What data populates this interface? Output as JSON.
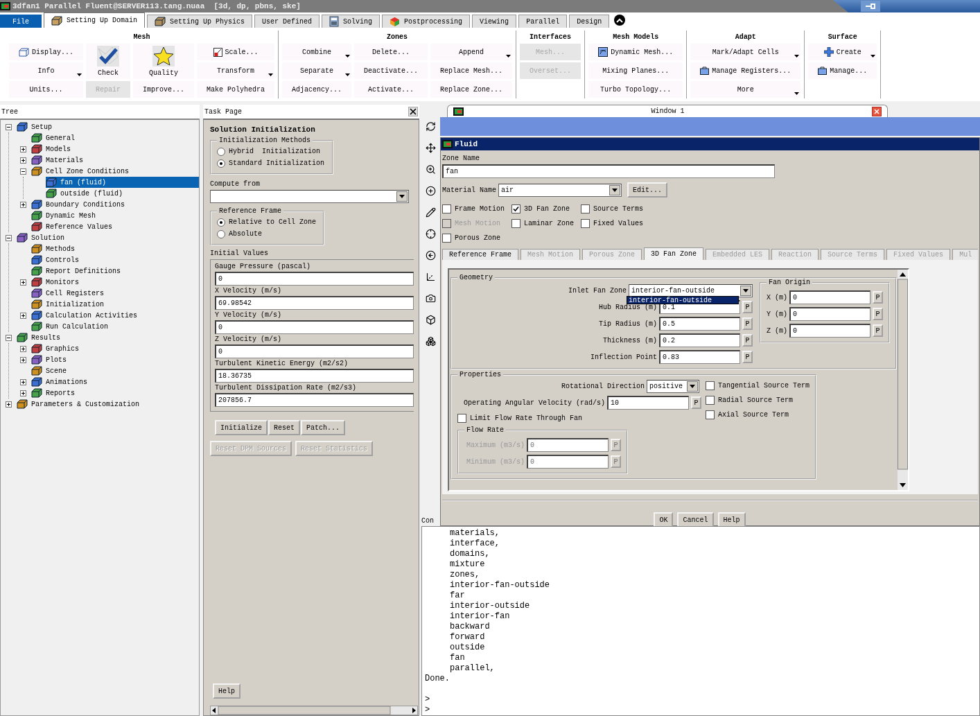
{
  "window": {
    "title": "3dfan1 Parallel Fluent@SERVER113.tang.nuaa  [3d, dp, pbns, ske]"
  },
  "ribbon_tabs": [
    {
      "label": "File",
      "kind": "file",
      "selected": false
    },
    {
      "label": "Setting Up Domain",
      "kind": "tab",
      "selected": true
    },
    {
      "label": "Setting Up Physics",
      "kind": "tab",
      "selected": false
    },
    {
      "label": "User Defined",
      "kind": "tab",
      "selected": false
    },
    {
      "label": "Solving",
      "kind": "tab",
      "selected": false
    },
    {
      "label": "Postprocessing",
      "kind": "tab",
      "selected": false
    },
    {
      "label": "Viewing",
      "kind": "tab",
      "selected": false
    },
    {
      "label": "Parallel",
      "kind": "tab",
      "selected": false
    },
    {
      "label": "Design",
      "kind": "tab",
      "selected": false
    }
  ],
  "ribbon_groups": [
    {
      "title": "Mesh",
      "columns": [
        [
          {
            "label": "Display...",
            "kind": "icon",
            "disabled": false
          },
          {
            "label": "Info",
            "kind": "menu",
            "disabled": false
          },
          {
            "label": "Units...",
            "kind": "plain",
            "disabled": false
          }
        ],
        [
          {
            "label": "Check",
            "kind": "large",
            "disabled": false
          },
          {
            "label": "Repair",
            "kind": "plain",
            "disabled": true
          }
        ],
        [
          {
            "label": "Quality",
            "kind": "large",
            "disabled": false
          },
          {
            "label": "Improve...",
            "kind": "plain",
            "disabled": false
          }
        ],
        [
          {
            "label": "Scale...",
            "kind": "icon",
            "disabled": false
          },
          {
            "label": "Transform",
            "kind": "menu",
            "disabled": false
          },
          {
            "label": "Make Polyhedra",
            "kind": "plain",
            "disabled": false
          }
        ]
      ]
    },
    {
      "title": "Zones",
      "columns": [
        [
          {
            "label": "Combine",
            "kind": "menu",
            "disabled": false
          },
          {
            "label": "Separate",
            "kind": "menu",
            "disabled": false
          },
          {
            "label": "Adjacency...",
            "kind": "plain",
            "disabled": false
          }
        ],
        [
          {
            "label": "Delete...",
            "kind": "plain",
            "disabled": false
          },
          {
            "label": "Deactivate...",
            "kind": "plain",
            "disabled": false
          },
          {
            "label": "Activate...",
            "kind": "plain",
            "disabled": false
          }
        ],
        [
          {
            "label": "Append",
            "kind": "menu",
            "disabled": false
          },
          {
            "label": "Replace Mesh...",
            "kind": "plain",
            "disabled": false
          },
          {
            "label": "Replace Zone...",
            "kind": "plain",
            "disabled": false
          }
        ]
      ]
    },
    {
      "title": "Interfaces",
      "columns": [
        [
          {
            "label": "Mesh...",
            "kind": "plain",
            "disabled": true
          },
          {
            "label": "Overset...",
            "kind": "plain",
            "disabled": true
          }
        ]
      ]
    },
    {
      "title": "Mesh Models",
      "columns": [
        [
          {
            "label": "Dynamic Mesh...",
            "kind": "icon",
            "disabled": false
          },
          {
            "label": "Mixing Planes...",
            "kind": "plain",
            "disabled": false
          },
          {
            "label": "Turbo Topology...",
            "kind": "plain",
            "disabled": false
          }
        ]
      ]
    },
    {
      "title": "Adapt",
      "columns": [
        [
          {
            "label": "Mark/Adapt Cells",
            "kind": "menu",
            "disabled": false
          },
          {
            "label": "Manage Registers...",
            "kind": "icon",
            "disabled": false
          },
          {
            "label": "More",
            "kind": "menu",
            "disabled": false
          }
        ]
      ]
    },
    {
      "title": "Surface",
      "columns": [
        [
          {
            "label": "Create",
            "kind": "icon-menu",
            "disabled": false
          },
          {
            "label": "Manage...",
            "kind": "icon",
            "disabled": false
          }
        ]
      ]
    }
  ],
  "tree": {
    "title": "Tree",
    "items": [
      {
        "label": "Setup",
        "expanded": true,
        "selected": false,
        "children": [
          {
            "label": "General",
            "selected": false
          },
          {
            "label": "Models",
            "expanded": false,
            "selected": false
          },
          {
            "label": "Materials",
            "expanded": false,
            "selected": false
          },
          {
            "label": "Cell Zone Conditions",
            "expanded": true,
            "selected": false,
            "children": [
              {
                "label": "fan (fluid)",
                "selected": true
              },
              {
                "label": "outside (fluid)",
                "selected": false
              }
            ]
          },
          {
            "label": "Boundary Conditions",
            "expanded": false,
            "selected": false
          },
          {
            "label": "Dynamic Mesh",
            "selected": false
          },
          {
            "label": "Reference Values",
            "selected": false
          }
        ]
      },
      {
        "label": "Solution",
        "expanded": true,
        "selected": false,
        "children": [
          {
            "label": "Methods",
            "selected": false
          },
          {
            "label": "Controls",
            "selected": false
          },
          {
            "label": "Report Definitions",
            "selected": false
          },
          {
            "label": "Monitors",
            "expanded": false,
            "selected": false
          },
          {
            "label": "Cell Registers",
            "selected": false
          },
          {
            "label": "Initialization",
            "selected": false
          },
          {
            "label": "Calculation Activities",
            "expanded": false,
            "selected": false
          },
          {
            "label": "Run Calculation",
            "selected": false
          }
        ]
      },
      {
        "label": "Results",
        "expanded": true,
        "selected": false,
        "children": [
          {
            "label": "Graphics",
            "expanded": false,
            "selected": false
          },
          {
            "label": "Plots",
            "expanded": false,
            "selected": false
          },
          {
            "label": "Scene",
            "selected": false
          },
          {
            "label": "Animations",
            "expanded": false,
            "selected": false
          },
          {
            "label": "Reports",
            "expanded": false,
            "selected": false
          }
        ]
      },
      {
        "label": "Parameters & Customization",
        "expanded": false,
        "selected": false
      }
    ]
  },
  "task_page": {
    "title": "Task Page",
    "heading": "Solution Initialization",
    "methods": {
      "legend": "Initialization Methods",
      "options": [
        {
          "label": "Hybrid  Initialization",
          "selected": false
        },
        {
          "label": "Standard Initialization",
          "selected": true
        }
      ]
    },
    "compute_from": {
      "label": "Compute from"
    },
    "reference_frame": {
      "legend": "Reference Frame",
      "options": [
        {
          "label": "Relative to Cell Zone",
          "selected": true
        },
        {
          "label": "Absolute",
          "selected": false
        }
      ]
    },
    "initial_values": {
      "label": "Initial Values",
      "fields": [
        {
          "label": "Gauge Pressure (pascal)",
          "value": "0"
        },
        {
          "label": "X Velocity (m/s)",
          "value": "69.98542"
        },
        {
          "label": "Y Velocity (m/s)",
          "value": "0"
        },
        {
          "label": "Z Velocity (m/s)",
          "value": "0"
        },
        {
          "label": "Turbulent Kinetic Energy (m2/s2)",
          "value": "18.36735"
        },
        {
          "label": "Turbulent Dissipation Rate (m2/s3)",
          "value": "207856.7"
        }
      ]
    },
    "buttons": [
      {
        "label": "Initialize",
        "disabled": false
      },
      {
        "label": "Reset",
        "disabled": false
      },
      {
        "label": "Patch...",
        "disabled": false
      }
    ],
    "reset_buttons": [
      {
        "label": "Reset DPM Sources",
        "disabled": true
      },
      {
        "label": "Reset Statistics",
        "disabled": true
      }
    ],
    "help": "Help"
  },
  "graphics_window": {
    "title": "Window 1"
  },
  "fluid_dialog": {
    "title": "Fluid",
    "zone_name": {
      "label": "Zone Name",
      "value": "fan"
    },
    "material": {
      "label": "Material Name",
      "value": "air",
      "button": "Edit..."
    },
    "options": [
      [
        {
          "label": "Frame Motion",
          "checked": false,
          "disabled": false
        },
        {
          "label": "3D Fan Zone",
          "checked": true,
          "disabled": false
        },
        {
          "label": "Source Terms",
          "checked": false,
          "disabled": false
        }
      ],
      [
        {
          "label": "Mesh Motion",
          "checked": false,
          "disabled": true
        },
        {
          "label": "Laminar Zone",
          "checked": false,
          "disabled": false
        },
        {
          "label": "Fixed Values",
          "checked": false,
          "disabled": false
        }
      ],
      [
        {
          "label": "Porous Zone",
          "checked": false,
          "disabled": false
        }
      ]
    ],
    "tabs": [
      {
        "label": "Reference Frame",
        "selected": false,
        "disabled": false
      },
      {
        "label": "Mesh Motion",
        "selected": false,
        "disabled": true
      },
      {
        "label": "Porous Zone",
        "selected": false,
        "disabled": true
      },
      {
        "label": "3D Fan Zone",
        "selected": true,
        "disabled": false
      },
      {
        "label": "Embedded LES",
        "selected": false,
        "disabled": true
      },
      {
        "label": "Reaction",
        "selected": false,
        "disabled": true
      },
      {
        "label": "Source Terms",
        "selected": false,
        "disabled": true
      },
      {
        "label": "Fixed Values",
        "selected": false,
        "disabled": true
      },
      {
        "label": "Mul",
        "selected": false,
        "disabled": true
      }
    ],
    "geometry": {
      "legend": "Geometry",
      "inlet_fan_zone": {
        "label": "Inlet Fan Zone",
        "value": "interior-fan-outside",
        "open_option": "interior-fan-outside"
      },
      "fields": [
        {
          "label": "Hub Radius (m)",
          "value": "0.1",
          "button": "P"
        },
        {
          "label": "Tip Radius (m)",
          "value": "0.5",
          "button": "P"
        },
        {
          "label": "Thickness (m)",
          "value": "0.2",
          "button": "P"
        },
        {
          "label": "Inflection Point",
          "value": "0.83",
          "button": "P"
        }
      ],
      "fan_origin": {
        "legend": "Fan Origin",
        "fields": [
          {
            "label": "X (m)",
            "value": "0",
            "button": "P"
          },
          {
            "label": "Y (m)",
            "value": "0",
            "button": "P"
          },
          {
            "label": "Z (m)",
            "value": "0",
            "button": "P"
          }
        ]
      }
    },
    "properties": {
      "legend": "Properties",
      "rotational_direction": {
        "label": "Rotational Direction",
        "value": "positive"
      },
      "angular_velocity": {
        "label": "Operating Angular Velocity (rad/s)",
        "value": "10",
        "button": "P"
      },
      "limit_flow": {
        "label": "Limit Flow Rate Through Fan",
        "checked": false
      },
      "flow_rate": {
        "legend": "Flow Rate",
        "fields": [
          {
            "label": "Maximum (m3/s)",
            "value": "0",
            "button": "P",
            "disabled": true
          },
          {
            "label": "Minimum (m3/s)",
            "value": "0",
            "button": "P",
            "disabled": true
          }
        ]
      },
      "source_terms": [
        {
          "label": "Tangential Source Term",
          "checked": false
        },
        {
          "label": "Radial Source Term",
          "checked": false
        },
        {
          "label": "Axial Source Term",
          "checked": false
        }
      ]
    },
    "buttons": [
      "OK",
      "Cancel",
      "Help"
    ]
  },
  "console": {
    "label": "Con",
    "lines": [
      {
        "text": "materials,",
        "kind": "item"
      },
      {
        "text": "interface,",
        "kind": "item"
      },
      {
        "text": "domains,",
        "kind": "item"
      },
      {
        "text": "mixture",
        "kind": "item"
      },
      {
        "text": "zones,",
        "kind": "item"
      },
      {
        "text": "interior-fan-outside",
        "kind": "item"
      },
      {
        "text": "far",
        "kind": "item"
      },
      {
        "text": "interior-outside",
        "kind": "item"
      },
      {
        "text": "interior-fan",
        "kind": "item"
      },
      {
        "text": "backward",
        "kind": "item"
      },
      {
        "text": "forward",
        "kind": "item"
      },
      {
        "text": "outside",
        "kind": "item"
      },
      {
        "text": "fan",
        "kind": "item"
      },
      {
        "text": "parallel,",
        "kind": "item"
      },
      {
        "text": "Done.",
        "kind": "plain"
      },
      {
        "text": ">",
        "kind": "prompt"
      },
      {
        "text": ">",
        "kind": "prompt"
      }
    ]
  }
}
